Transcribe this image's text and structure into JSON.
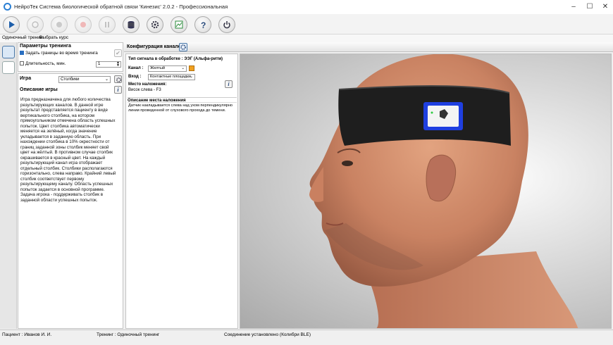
{
  "window": {
    "title": "НейроТек Система биологической обратной связи 'Кинезис' 2.0.2 - Профессиональная"
  },
  "menu": {
    "items": [
      "Одиночный тренинг",
      "Выбрать курс"
    ]
  },
  "training_params": {
    "title": "Параметры тренинга",
    "set_bounds_label": "Задать границы во время тренинга",
    "set_bounds_checked": true,
    "duration_label": "Длительность, мин.",
    "duration_checked": false,
    "duration_value": "1"
  },
  "game": {
    "label": "Игра",
    "selected": "Столбики",
    "description_title": "Описание игры",
    "description": "Игра предназначена для любого количества результирующих каналов. В данной игре результат представляется пациенту в виде вертикального столбика, на котором прямоугольником отмечена область успешных попыток. Цвет столбика автоматически меняется на зелёный, когда значение укладывается в заданную область. При нахождении столбика в 10% окрестности от границ заданной зоны столбик меняет свой цвет на жёлтый. В противном случае столбик окрашивается в красный цвет. На каждый результирующий канал игра отображает отдельный столбик. Столбики располагаются горизонтально, слева направо. Крайний левый столбик соответствует первому результирующему каналу. Область успешных попыток задается в основной программе. Задача игрока - поддерживать столбик в заданной области успешных попыток."
  },
  "config": {
    "title": "Конфигурация каналов",
    "signal_type": "Тип сигнала в обработке : ЭЭГ (Альфа-ритм)",
    "channel_label": "Канал :",
    "channel_value": "Желтый",
    "channel_color": "#f0a020",
    "input_label": "Вход :",
    "input_value": "Контактные площадки",
    "placement_label": "Место наложения:",
    "placement_value": "Висок слева - F3",
    "placement_desc_title": "Описание места наложения",
    "placement_desc": "Датчик накладывается слева над ухом перпендикулярно линии проведенной от слухового прохода до темени."
  },
  "status": {
    "patient": "Пациент : Иванов И. И.",
    "training": "Тренинг : Одиночный тренинг",
    "connection": "Соединение установлено (Колибри BLE)"
  },
  "colors": {
    "accent": "#2a7fd4",
    "skin": "#d4906c",
    "band": "#1e1e1e",
    "sensor": "#1f3fe0"
  },
  "icons": [
    "play-icon",
    "record-icon",
    "stop-icon",
    "pause-icon",
    "database-icon",
    "gear-icon",
    "chart-icon",
    "help-icon",
    "power-icon"
  ]
}
